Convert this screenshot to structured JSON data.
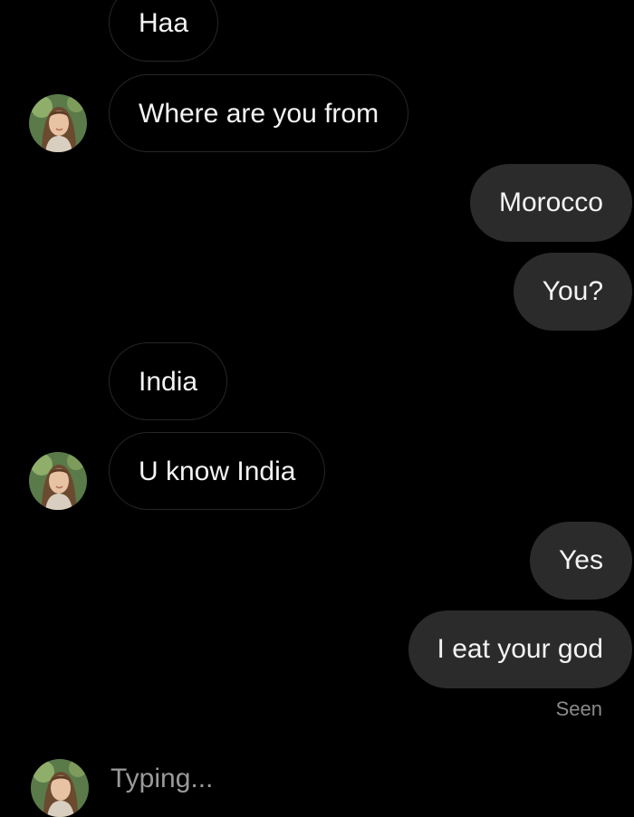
{
  "messages": [
    {
      "text": "Haa",
      "direction": "incoming"
    },
    {
      "text": "Where are you from",
      "direction": "incoming"
    },
    {
      "text": "Morocco",
      "direction": "outgoing"
    },
    {
      "text": "You?",
      "direction": "outgoing"
    },
    {
      "text": "India",
      "direction": "incoming"
    },
    {
      "text": "U know India",
      "direction": "incoming"
    },
    {
      "text": "Yes",
      "direction": "outgoing"
    },
    {
      "text": "I eat your god",
      "direction": "outgoing"
    }
  ],
  "status": {
    "seen_label": "Seen",
    "typing_label": "Typing..."
  },
  "colors": {
    "background": "#000000",
    "outgoing_bubble": "#2b2b2b",
    "incoming_border": "#262626",
    "muted_text": "#8a8a8a"
  },
  "icons": {
    "avatar": "contact-avatar-photo"
  }
}
